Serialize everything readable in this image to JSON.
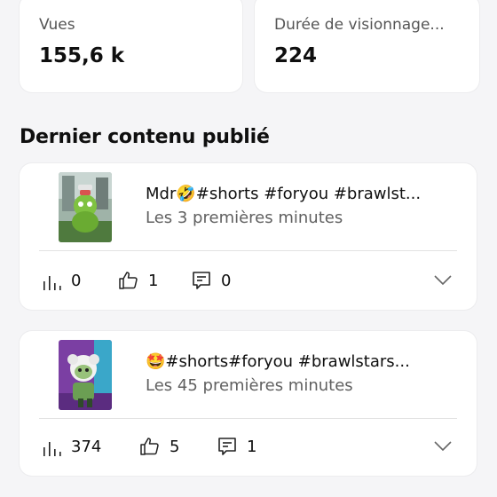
{
  "stats": {
    "views": {
      "label": "Vues",
      "value": "155,6 k"
    },
    "watch_time": {
      "label": "Durée de visionnage...",
      "value": "224"
    }
  },
  "section_title": "Dernier contenu publié",
  "videos": [
    {
      "title": "Mdr🤣#shorts #foryou #brawlst...",
      "subtitle": "Les 3 premières minutes",
      "views": "0",
      "likes": "1",
      "comments": "0"
    },
    {
      "title": "🤩#shorts#foryou #brawlstars...",
      "subtitle": "Les 45 premières minutes",
      "views": "374",
      "likes": "5",
      "comments": "1"
    }
  ],
  "icons": {
    "views": "bar-chart-icon",
    "likes": "thumbs-up-icon",
    "comments": "comment-icon",
    "expand": "chevron-down-icon"
  },
  "colors": {
    "background": "#f5f5f7",
    "card": "#ffffff",
    "secondary_text": "#606060"
  }
}
